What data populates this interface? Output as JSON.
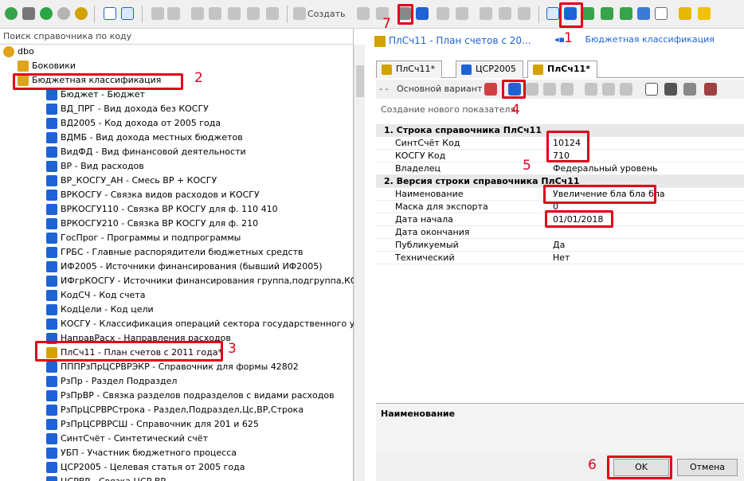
{
  "toolbar": {
    "create_label": "Создать"
  },
  "left": {
    "search_placeholder": "Поиск справочника по коду"
  },
  "tree": {
    "root": "dbo",
    "items": [
      "Боковики",
      "Бюджетная классификация",
      "Бюджет - Бюджет",
      "ВД_ПРГ - Вид дохода без КОСГУ",
      "ВД2005 - Код дохода от 2005 года",
      "ВДМБ - Вид дохода местных бюджетов",
      "ВидФД - Вид финансовой деятельности",
      "ВР - Вид расходов",
      "ВР_КОСГУ_АН - Смесь ВР + КОСГУ",
      "ВРКОСГУ - Связка видов расходов и КОСГУ",
      "ВРКОСГУ110 - Связка ВР КОСГУ для ф. 110 410",
      "ВРКОСГУ210 - Связка ВР КОСГУ для ф. 210",
      "ГосПрог - Программы и подпрограммы",
      "ГРБС - Главные распорядители бюджетных средств",
      "ИФ2005 - Источники финансирования (бывший ИФ2005)",
      "ИФгрКОСГУ - Источники финансирования группа,подгруппа,КОС",
      "КодСЧ - Код счета",
      "КодЦели - Код цели",
      "КОСГУ - Классификация  операций сектора государственного уче",
      "НаправРасх - Направления расходов",
      "ПлСч11 - План счетов с 2011 года*",
      "ПППРзПрЦСРВРЭКР - Справочник для формы 42802",
      "РзПр - Раздел Подраздел",
      "РзПрВР - Связка разделов подразделов с видами расходов",
      "РзПрЦСРВРСтрока - Раздел,Подраздел,Цс,ВР,Строка",
      "РзПрЦСРВРСШ - Справочник для 201 и 625",
      "СинтСчёт - Синтетический счёт",
      "УБП - Участник бюджетного процесса",
      "ЦСР2005 - Целевая статья от 2005 года",
      "ЦСРВР - Связка ЦСР ВР"
    ]
  },
  "right": {
    "doc_tab": "ПлСч11 - План счетов с 20...",
    "breadcrumb": "Бюджетная классификация",
    "tabs": [
      "ПлСч11*",
      "ЦСР2005",
      "ПлСч11*"
    ],
    "variant": "Основной вариант",
    "panel_title": "Создание нового показателя",
    "sections": [
      {
        "title": "1. Строка справочника ПлСч11",
        "rows": [
          [
            "СинтСчёт Код",
            "10124"
          ],
          [
            "КОСГУ Код",
            "710"
          ],
          [
            "Владелец",
            "Федеральный уровень"
          ]
        ]
      },
      {
        "title": "2. Версия строки справочника ПлСч11",
        "rows": [
          [
            "Наименование",
            "Увеличение бла бла бла"
          ],
          [
            "Маска для экспорта",
            "0"
          ],
          [
            "Дата начала",
            "01/01/2018"
          ],
          [
            "Дата окончания",
            ""
          ],
          [
            "Публикуемый",
            "Да"
          ],
          [
            "Технический",
            "Нет"
          ]
        ]
      }
    ],
    "desc_title": "Наименование",
    "ok": "OK",
    "cancel": "Отмена"
  },
  "annotations": [
    "1",
    "2",
    "3",
    "4",
    "5",
    "6",
    "7"
  ],
  "colors": {
    "mark": "#e0001b",
    "cube": "#1d63d6"
  }
}
